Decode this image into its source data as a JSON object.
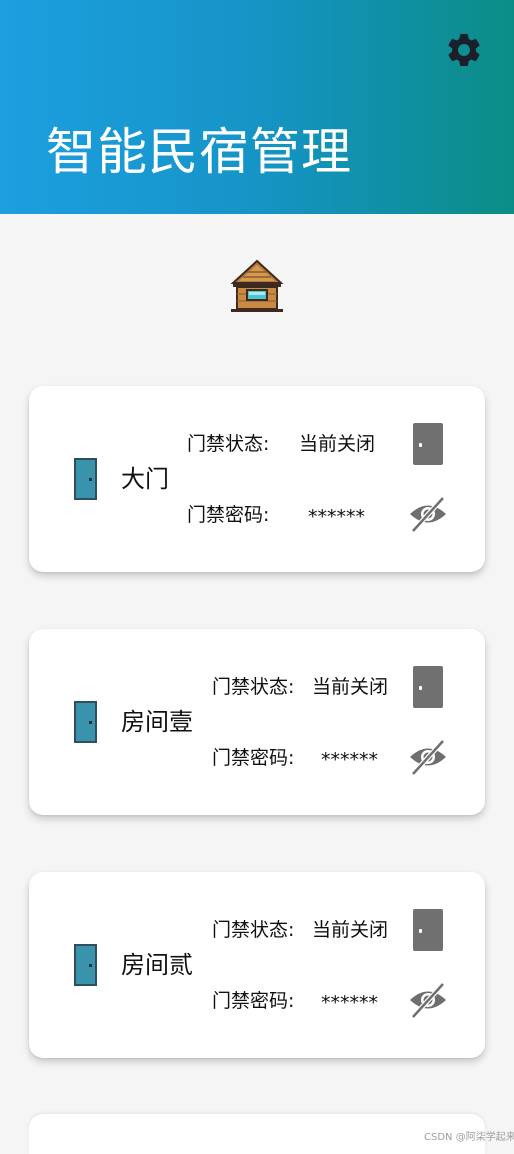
{
  "header": {
    "title": "智能民宿管理",
    "settings_icon": "gear-icon",
    "gradient": [
      "#1d9fe0",
      "#0b8d86"
    ]
  },
  "logo": {
    "icon": "wooden-house-icon"
  },
  "labels": {
    "status_label": "门禁状态:",
    "password_label": "门禁密码:"
  },
  "rooms": [
    {
      "name": "大门",
      "status": "当前关闭",
      "password": "******"
    },
    {
      "name": "房间壹",
      "status": "当前关闭",
      "password": "******"
    },
    {
      "name": "房间贰",
      "status": "当前关闭",
      "password": "******"
    }
  ],
  "colors": {
    "door_blue": "#3a93ad",
    "door_gray": "#707070",
    "eye_gray": "#6f6f6f"
  },
  "watermark": "CSDN @阿柒学起来"
}
